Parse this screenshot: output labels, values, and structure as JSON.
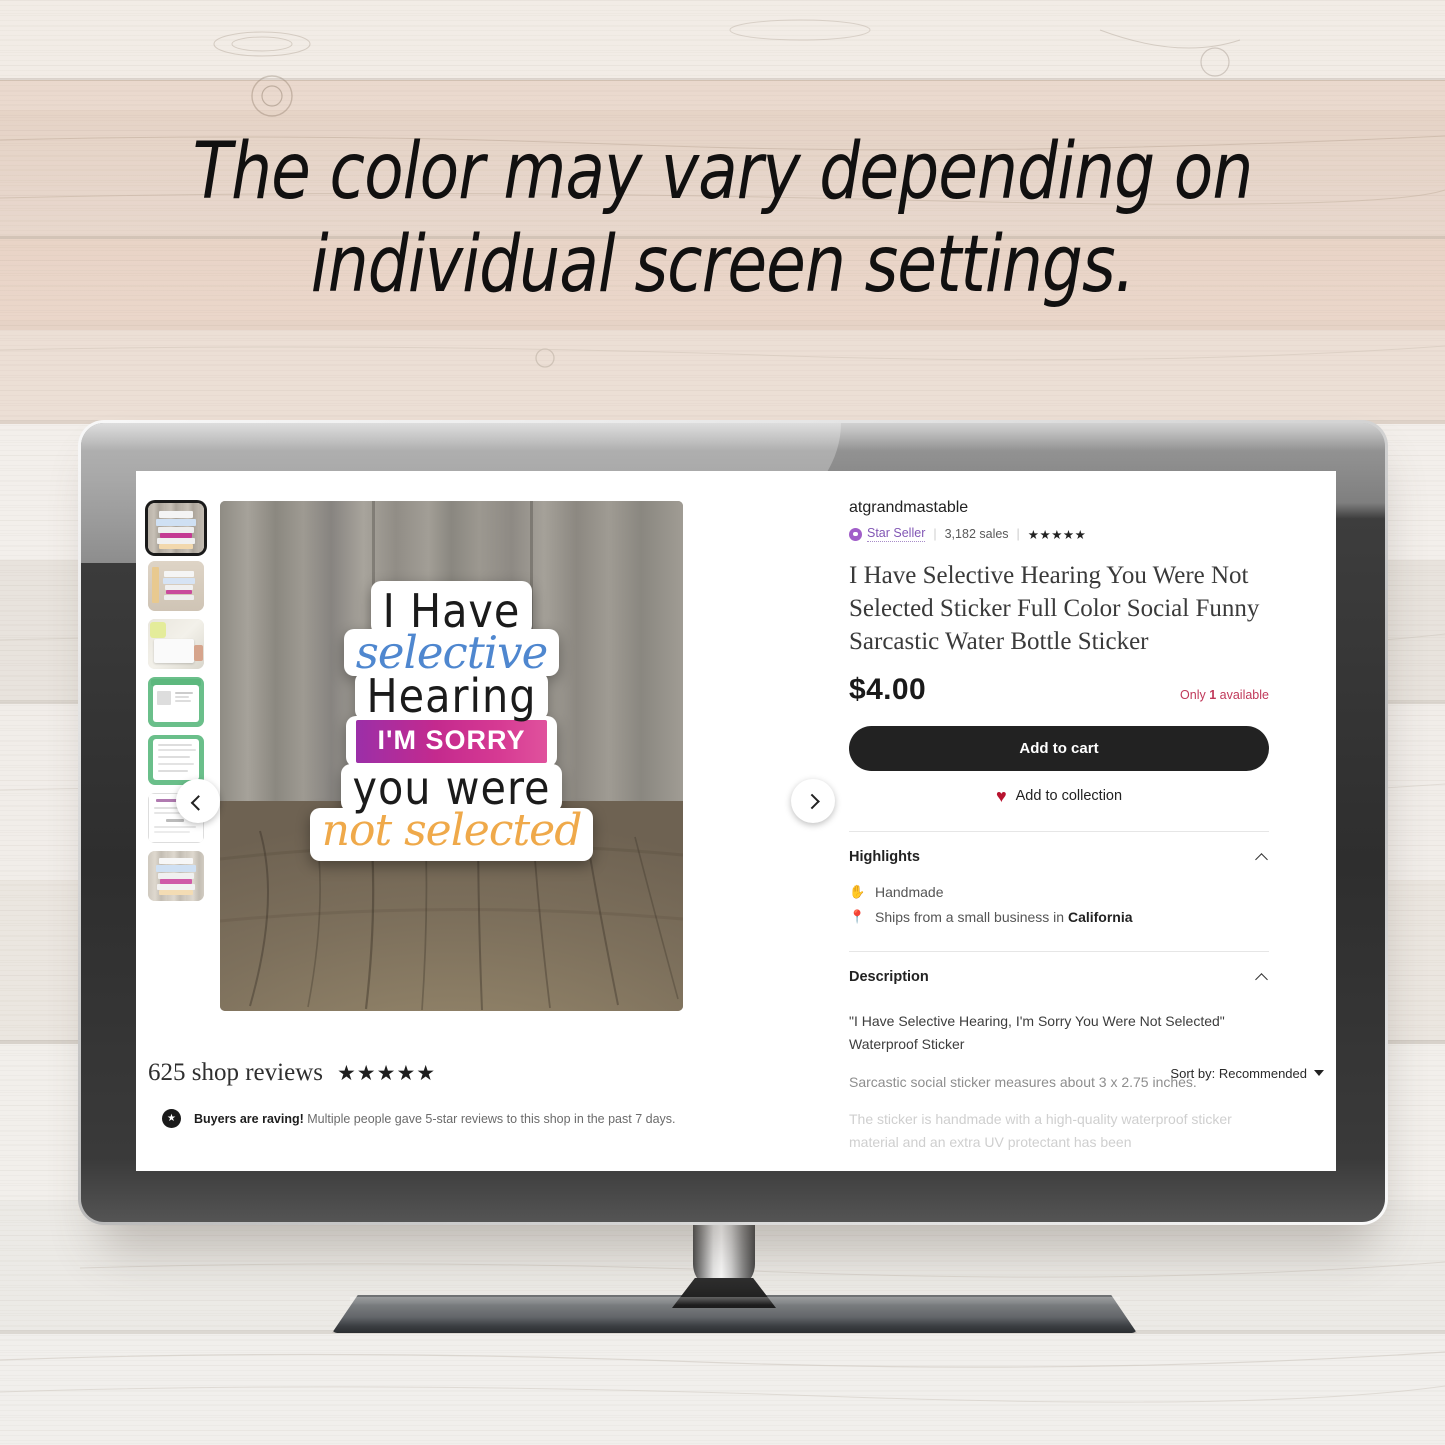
{
  "overlay": {
    "headline_line1": "The color may vary depending on",
    "headline_line2": "individual screen settings."
  },
  "listing": {
    "shop_name": "atgrandmastable",
    "star_seller_label": "Star Seller",
    "sales": "3,182 sales",
    "seller_rating_stars": "★★★★★",
    "title": "I Have Selective Hearing You Were Not Selected Sticker Full Color Social Funny Sarcastic Water Bottle Sticker",
    "price": "$4.00",
    "availability_prefix": "Only ",
    "availability_count": "1",
    "availability_suffix": " available",
    "add_to_cart_label": "Add to cart",
    "add_to_collection_label": "Add to collection",
    "heart_icon": "♥"
  },
  "highlights": {
    "section_title": "Highlights",
    "items": [
      {
        "icon": "hand-icon",
        "glyph": "✋",
        "text": "Handmade",
        "bold_text": ""
      },
      {
        "icon": "location-pin-icon",
        "glyph": "📍",
        "text": "Ships from a small business in ",
        "bold_text": "California"
      }
    ]
  },
  "description": {
    "section_title": "Description",
    "paragraph1": "\"I Have Selective Hearing, I'm Sorry You Were Not Selected\" Waterproof Sticker",
    "paragraph2": "Sarcastic social sticker measures about 3 x 2.75 inches.",
    "paragraph3": "The sticker is handmade with a high-quality waterproof sticker material and an extra UV protectant has been"
  },
  "reviews": {
    "count_label": "625 shop reviews",
    "stars": "★★★★★",
    "sort_label": "Sort by: Recommended",
    "banner_icon": "star-badge-icon",
    "banner_bold": "Buyers are raving!",
    "banner_text": " Multiple people gave 5-star reviews to this shop in the past 7 days."
  },
  "gallery": {
    "prev_icon": "chevron-left-icon",
    "next_icon": "chevron-right-icon",
    "thumbnail_count": 7,
    "selected_index": 0,
    "sticker_text": {
      "line1": "I Have",
      "line2": "selective",
      "line3": "Hearing",
      "line4": "I'M SORRY",
      "line5": "you were",
      "line6": "not selected"
    }
  },
  "colors": {
    "accent_purple": "#8257b5",
    "price_red": "#c0395a",
    "heart_red": "#b8132f",
    "button_black": "#222222",
    "sticker_blue": "#4f87cf",
    "sticker_orange": "#efa94a",
    "sticker_magenta": "#c42a8e"
  }
}
